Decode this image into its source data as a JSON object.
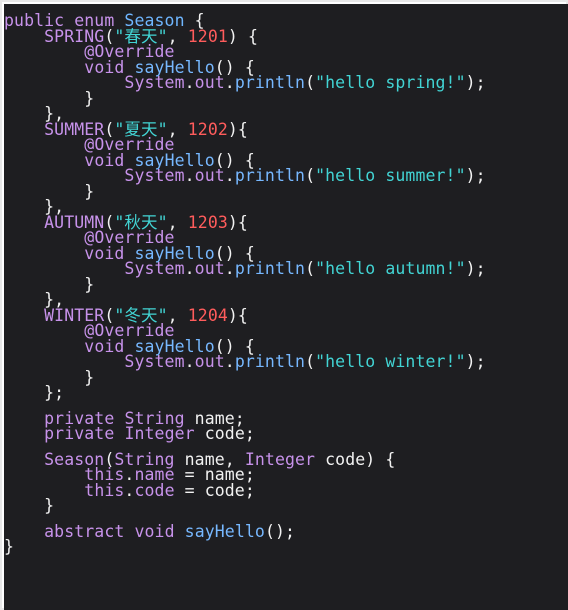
{
  "code_lines": [
    [
      {
        "t": "public enum ",
        "c": "kw"
      },
      {
        "t": "Season",
        "c": "type"
      },
      {
        "t": " {",
        "c": "plain"
      }
    ],
    [
      {
        "t": "    SPRING",
        "c": "enum"
      },
      {
        "t": "(",
        "c": "plain"
      },
      {
        "t": "\"春天\"",
        "c": "str"
      },
      {
        "t": ", ",
        "c": "plain"
      },
      {
        "t": "1201",
        "c": "num"
      },
      {
        "t": ") {",
        "c": "plain"
      }
    ],
    [
      {
        "t": "        ",
        "c": "plain"
      },
      {
        "t": "@Override",
        "c": "ann"
      }
    ],
    [
      {
        "t": "        ",
        "c": "plain"
      },
      {
        "t": "void",
        "c": "kw"
      },
      {
        "t": " ",
        "c": "plain"
      },
      {
        "t": "sayHello",
        "c": "fn"
      },
      {
        "t": "() {",
        "c": "plain"
      }
    ],
    [
      {
        "t": "            ",
        "c": "plain"
      },
      {
        "t": "System",
        "c": "purple"
      },
      {
        "t": ".",
        "c": "plain"
      },
      {
        "t": "out",
        "c": "purple"
      },
      {
        "t": ".",
        "c": "plain"
      },
      {
        "t": "println",
        "c": "fn"
      },
      {
        "t": "(",
        "c": "plain"
      },
      {
        "t": "\"hello spring!\"",
        "c": "str"
      },
      {
        "t": ");",
        "c": "plain"
      }
    ],
    [
      {
        "t": "        }",
        "c": "plain"
      }
    ],
    [
      {
        "t": "    },",
        "c": "plain"
      }
    ],
    [
      {
        "t": "    SUMMER",
        "c": "enum"
      },
      {
        "t": "(",
        "c": "plain"
      },
      {
        "t": "\"夏天\"",
        "c": "str"
      },
      {
        "t": ", ",
        "c": "plain"
      },
      {
        "t": "1202",
        "c": "num"
      },
      {
        "t": "){",
        "c": "plain"
      }
    ],
    [
      {
        "t": "        ",
        "c": "plain"
      },
      {
        "t": "@Override",
        "c": "ann"
      }
    ],
    [
      {
        "t": "        ",
        "c": "plain"
      },
      {
        "t": "void",
        "c": "kw"
      },
      {
        "t": " ",
        "c": "plain"
      },
      {
        "t": "sayHello",
        "c": "fn"
      },
      {
        "t": "() {",
        "c": "plain"
      }
    ],
    [
      {
        "t": "            ",
        "c": "plain"
      },
      {
        "t": "System",
        "c": "purple"
      },
      {
        "t": ".",
        "c": "plain"
      },
      {
        "t": "out",
        "c": "purple"
      },
      {
        "t": ".",
        "c": "plain"
      },
      {
        "t": "println",
        "c": "fn"
      },
      {
        "t": "(",
        "c": "plain"
      },
      {
        "t": "\"hello summer!\"",
        "c": "str"
      },
      {
        "t": ");",
        "c": "plain"
      }
    ],
    [
      {
        "t": "        }",
        "c": "plain"
      }
    ],
    [
      {
        "t": "    },",
        "c": "plain"
      }
    ],
    [
      {
        "t": "    AUTUMN",
        "c": "enum"
      },
      {
        "t": "(",
        "c": "plain"
      },
      {
        "t": "\"秋天\"",
        "c": "str"
      },
      {
        "t": ", ",
        "c": "plain"
      },
      {
        "t": "1203",
        "c": "num"
      },
      {
        "t": "){",
        "c": "plain"
      }
    ],
    [
      {
        "t": "        ",
        "c": "plain"
      },
      {
        "t": "@Override",
        "c": "ann"
      }
    ],
    [
      {
        "t": "        ",
        "c": "plain"
      },
      {
        "t": "void",
        "c": "kw"
      },
      {
        "t": " ",
        "c": "plain"
      },
      {
        "t": "sayHello",
        "c": "fn"
      },
      {
        "t": "() {",
        "c": "plain"
      }
    ],
    [
      {
        "t": "            ",
        "c": "plain"
      },
      {
        "t": "System",
        "c": "purple"
      },
      {
        "t": ".",
        "c": "plain"
      },
      {
        "t": "out",
        "c": "purple"
      },
      {
        "t": ".",
        "c": "plain"
      },
      {
        "t": "println",
        "c": "fn"
      },
      {
        "t": "(",
        "c": "plain"
      },
      {
        "t": "\"hello autumn!\"",
        "c": "str"
      },
      {
        "t": ");",
        "c": "plain"
      }
    ],
    [
      {
        "t": "        }",
        "c": "plain"
      }
    ],
    [
      {
        "t": "    },",
        "c": "plain"
      }
    ],
    [
      {
        "t": "    WINTER",
        "c": "enum"
      },
      {
        "t": "(",
        "c": "plain"
      },
      {
        "t": "\"冬天\"",
        "c": "str"
      },
      {
        "t": ", ",
        "c": "plain"
      },
      {
        "t": "1204",
        "c": "num"
      },
      {
        "t": "){",
        "c": "plain"
      }
    ],
    [
      {
        "t": "        ",
        "c": "plain"
      },
      {
        "t": "@Override",
        "c": "ann"
      }
    ],
    [
      {
        "t": "        ",
        "c": "plain"
      },
      {
        "t": "void",
        "c": "kw"
      },
      {
        "t": " ",
        "c": "plain"
      },
      {
        "t": "sayHello",
        "c": "fn"
      },
      {
        "t": "() {",
        "c": "plain"
      }
    ],
    [
      {
        "t": "            ",
        "c": "plain"
      },
      {
        "t": "System",
        "c": "purple"
      },
      {
        "t": ".",
        "c": "plain"
      },
      {
        "t": "out",
        "c": "purple"
      },
      {
        "t": ".",
        "c": "plain"
      },
      {
        "t": "println",
        "c": "fn"
      },
      {
        "t": "(",
        "c": "plain"
      },
      {
        "t": "\"hello winter!\"",
        "c": "str"
      },
      {
        "t": ");",
        "c": "plain"
      }
    ],
    [
      {
        "t": "        }",
        "c": "plain"
      }
    ],
    [
      {
        "t": "    };",
        "c": "plain"
      }
    ],
    [],
    [
      {
        "t": "    ",
        "c": "plain"
      },
      {
        "t": "private",
        "c": "kw"
      },
      {
        "t": " ",
        "c": "plain"
      },
      {
        "t": "String",
        "c": "purple"
      },
      {
        "t": " name;",
        "c": "plain"
      }
    ],
    [
      {
        "t": "    ",
        "c": "plain"
      },
      {
        "t": "private",
        "c": "kw"
      },
      {
        "t": " ",
        "c": "plain"
      },
      {
        "t": "Integer",
        "c": "purple"
      },
      {
        "t": " code;",
        "c": "plain"
      }
    ],
    [],
    [
      {
        "t": "    ",
        "c": "plain"
      },
      {
        "t": "Season",
        "c": "purple"
      },
      {
        "t": "(",
        "c": "plain"
      },
      {
        "t": "String",
        "c": "purple"
      },
      {
        "t": " name, ",
        "c": "plain"
      },
      {
        "t": "Integer",
        "c": "purple"
      },
      {
        "t": " code) {",
        "c": "plain"
      }
    ],
    [
      {
        "t": "        ",
        "c": "plain"
      },
      {
        "t": "this",
        "c": "kw"
      },
      {
        "t": ".",
        "c": "plain"
      },
      {
        "t": "name",
        "c": "purple"
      },
      {
        "t": " = name;",
        "c": "plain"
      }
    ],
    [
      {
        "t": "        ",
        "c": "plain"
      },
      {
        "t": "this",
        "c": "kw"
      },
      {
        "t": ".",
        "c": "plain"
      },
      {
        "t": "code",
        "c": "purple"
      },
      {
        "t": " = code;",
        "c": "plain"
      }
    ],
    [
      {
        "t": "    }",
        "c": "plain"
      }
    ],
    [],
    [
      {
        "t": "    ",
        "c": "plain"
      },
      {
        "t": "abstract",
        "c": "kw"
      },
      {
        "t": " ",
        "c": "plain"
      },
      {
        "t": "void",
        "c": "kw"
      },
      {
        "t": " ",
        "c": "plain"
      },
      {
        "t": "sayHello",
        "c": "fn"
      },
      {
        "t": "();",
        "c": "plain"
      }
    ],
    [
      {
        "t": "}",
        "c": "plain"
      }
    ]
  ],
  "colors": {
    "background": "#1e1e21",
    "keyword": "#c792ea",
    "type": "#6fb6ff",
    "string": "#42d4d4",
    "number": "#ff5c5c",
    "function": "#77b8ff",
    "plain": "#f2f2f2"
  }
}
